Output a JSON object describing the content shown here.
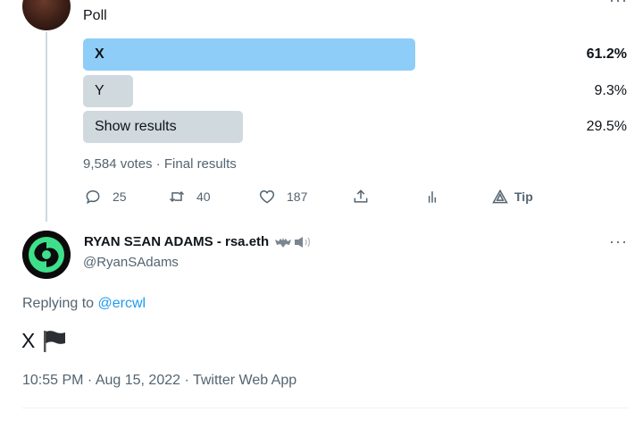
{
  "top_tweet": {
    "poll_label": "Poll",
    "poll": {
      "options": [
        {
          "label": "X",
          "percent_text": "61.2%",
          "fraction": 0.612
        },
        {
          "label": "Y",
          "percent_text": "9.3%",
          "fraction": 0.093
        },
        {
          "label": "Show results",
          "percent_text": "29.5%",
          "fraction": 0.295
        }
      ],
      "summary": "9,584 votes · Final results"
    },
    "actions": {
      "reply_count": "25",
      "retweet_count": "40",
      "like_count": "187",
      "tip_label": "Tip"
    },
    "icons": [
      "reply-icon",
      "retweet-icon",
      "like-icon",
      "share-icon",
      "analytics-icon",
      "tip-icon"
    ]
  },
  "main_tweet": {
    "display_name": "RYAN SΞAN ADAMS - rsa.eth",
    "handle": "@RyanSAdams",
    "more_label": "···",
    "replying_prefix": "Replying to",
    "replying_to": "@ercwl",
    "text": "X",
    "timestamp": "10:55 PM · Aug 15, 2022 · Twitter Web App"
  },
  "colors": {
    "accent": "#1d9bf0",
    "poll_winner": "#8ecdf8",
    "poll_other": "#cfd9de",
    "muted_text": "#536471",
    "avatar_ring": "#3fe08c"
  }
}
